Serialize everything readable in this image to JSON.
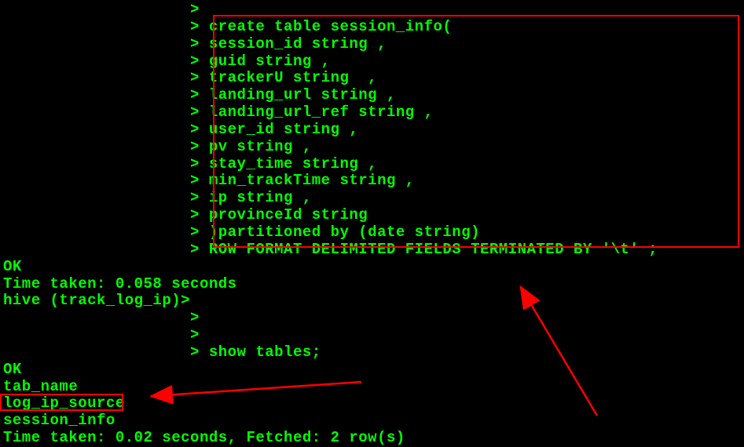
{
  "terminal": {
    "lines": [
      "                    >",
      "                    > create table session_info(",
      "                    > session_id string ,",
      "                    > guid string ,",
      "                    > trackerU string  ,",
      "                    > landing_url string ,",
      "                    > landing_url_ref string ,",
      "                    > user_id string ,",
      "                    > pv string ,",
      "                    > stay_time string ,",
      "                    > min_trackTime string ,",
      "                    > ip string ,",
      "                    > provinceId string",
      "                    > )partitioned by (date string)",
      "                    > ROW FORMAT DELIMITED FIELDS TERMINATED BY '\\t' ;",
      "OK",
      "Time taken: 0.058 seconds",
      "hive (track_log_ip)>",
      "                    >",
      "                    >",
      "                    > show tables;",
      "OK",
      "tab_name",
      "log_ip_source",
      "session_info",
      "Time taken: 0.02 seconds, Fetched: 2 row(s)"
    ]
  },
  "annotations": {
    "arrow1_color": "#ff0000",
    "arrow2_color": "#ff0000"
  }
}
